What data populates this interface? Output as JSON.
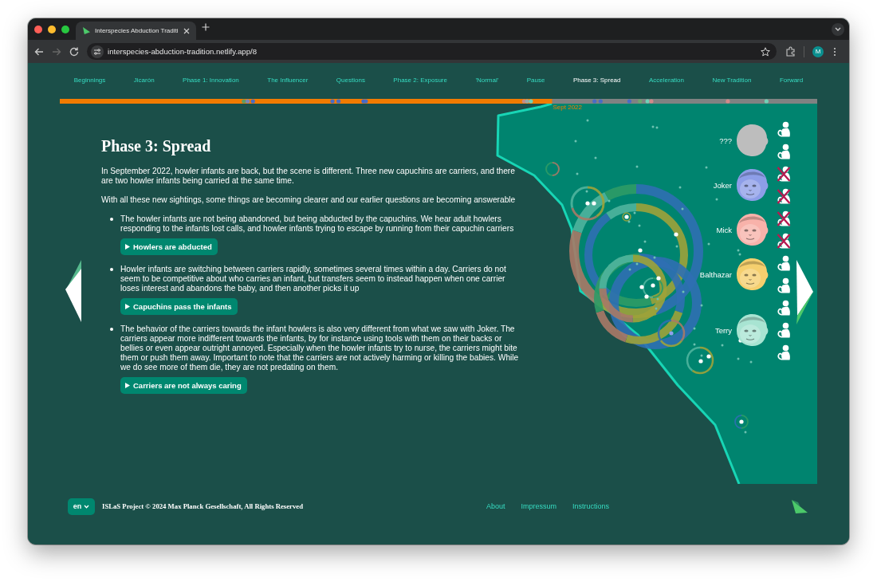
{
  "browser": {
    "tabs": [
      {
        "title": "Interspecies Abduction Traditi",
        "selected": true
      }
    ],
    "url": "interspecies-abduction-tradition.netlify.app/8",
    "can_go_back": true,
    "can_go_forward": false,
    "profile_initial": "M"
  },
  "nav": [
    {
      "label": "Beginnings",
      "selected": false
    },
    {
      "label": "Jicarón",
      "selected": false
    },
    {
      "label": "Phase 1: Innovation",
      "selected": false
    },
    {
      "label": "The Influencer",
      "selected": false
    },
    {
      "label": "Questions",
      "selected": false
    },
    {
      "label": "Phase 2: Exposure",
      "selected": false
    },
    {
      "label": "'Normal'",
      "selected": false
    },
    {
      "label": "Pause",
      "selected": false
    },
    {
      "label": "Phase 3: Spread",
      "selected": true
    },
    {
      "label": "Acceleration",
      "selected": false
    },
    {
      "label": "New Tradition",
      "selected": false
    },
    {
      "label": "Forward",
      "selected": false
    }
  ],
  "timeline": {
    "level": 0.65,
    "marker_label": "Sept 2022"
  },
  "article": {
    "title": "Phase 3: Spread",
    "paragraphs": [
      "In September 2022, howler infants are back, but the scene is different. Three new capuchins are carriers, and there are two howler infants being carried at the same time.",
      "With all these new sightings, some things are becoming clearer and our earlier questions are becoming answerable"
    ],
    "points": [
      {
        "text": "The howler infants are not being abandoned, but being abducted by the capuchins. We hear adult howlers responding to the infants lost calls, and howler infants trying to escape by running from their capuchin carriers",
        "toggle": {
          "label": "Howlers are abducted",
          "expanded": false
        }
      },
      {
        "text": "Howler infants are switching between carriers rapidly, sometimes several times within a day. Carriers do not seem to be competitive about who carries an infant, but transfers seem to instead happen when one carrier loses interest and abandons the baby, and then another picks it up",
        "toggle": {
          "label": "Capuchins pass the infants",
          "expanded": false
        }
      },
      {
        "text": "The behavior of the carriers towards the infant howlers is also very different from what we saw with Joker. The carriers appear more indifferent towards the infants, by for instance using tools with them on their backs or bellies or even appear outright annoyed. Especially when the howler infants try to nurse, the carriers might bite them or push them away. Important to note that the carriers are not actively harming or killing the babies. While we do see more of them die, they are not predating on them.",
        "toggle": {
          "label": "Carriers are not always caring",
          "expanded": false
        }
      }
    ]
  },
  "carriers": [
    {
      "name": "???",
      "kind": "silhouette",
      "color": "#bdbdbd",
      "infants": [
        {
          "crossed_out": false
        },
        {
          "crossed_out": false
        }
      ]
    },
    {
      "name": "Joker",
      "kind": "face",
      "color": "#8d9ee8",
      "infants": [
        {
          "crossed_out": true
        },
        {
          "crossed_out": true
        }
      ]
    },
    {
      "name": "Mick",
      "kind": "face",
      "color": "#f8b2aa",
      "infants": [
        {
          "crossed_out": true
        },
        {
          "crossed_out": true
        }
      ]
    },
    {
      "name": "Balthazar",
      "kind": "face",
      "color": "#f5cf6e",
      "infants": [
        {
          "crossed_out": false
        },
        {
          "crossed_out": false
        }
      ]
    },
    {
      "name": "Terry",
      "kind": "face",
      "color": "#a8e4d2",
      "infants": [
        {
          "crossed_out": false
        },
        {
          "crossed_out": false
        },
        {
          "crossed_out": false
        }
      ]
    }
  ],
  "footer": {
    "language": "en",
    "copyright": "ISLaS Project © 2024 Max Planck Gesellschaft, All Rights Reserved",
    "links": [
      "About",
      "Impressum",
      "Instructions"
    ]
  }
}
